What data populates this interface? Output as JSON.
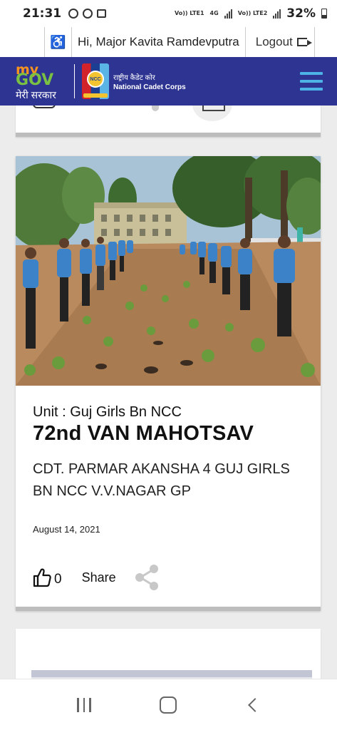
{
  "status_bar": {
    "time": "21:31",
    "sim1": "Vo)) LTE1",
    "net_type": "4G",
    "sim2": "Vo)) LTE2",
    "battery": "32%"
  },
  "user_bar": {
    "greeting": "Hi, Major Kavita Ramdevputra",
    "logout_label": "Logout"
  },
  "header": {
    "mygov_my": "my",
    "mygov_gov": "GOV",
    "mygov_tagline": "मेरी सरकार",
    "ncc_hindi": "राष्ट्रीय कैडेट कोर",
    "ncc_english": "National Cadet Corps",
    "ncc_badge": "NCC",
    "bg_color": "#2e3492"
  },
  "post": {
    "unit": "Unit : Guj Girls Bn NCC",
    "title": "72nd VAN MAHOTSAV",
    "description": "CDT. PARMAR AKANSHA 4 GUJ GIRLS BN NCC V.V.NAGAR GP",
    "date": "August 14, 2021",
    "like_count": "0",
    "share_label": "Share"
  }
}
